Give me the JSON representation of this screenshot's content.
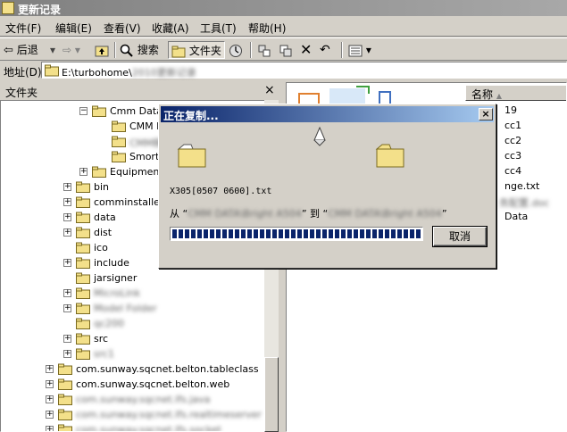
{
  "window": {
    "title": "更新记录"
  },
  "menu": [
    "文件(F)",
    "编辑(E)",
    "查看(V)",
    "收藏(A)",
    "工具(T)",
    "帮助(H)"
  ],
  "toolbar": {
    "back": "后退",
    "search": "搜索",
    "folders": "文件夹"
  },
  "address": {
    "label": "地址(D)",
    "path": "E:\\turbohome\\",
    "path_blurred": "2010更新记录"
  },
  "folders_pane": {
    "title": "文件夹",
    "close": "×"
  },
  "tree": [
    {
      "label": "Cmm Data",
      "expander": "−",
      "blurred": false
    },
    {
      "label": "CMM D",
      "expander": "",
      "blurred": false
    },
    {
      "label": "CMM精",
      "expander": "",
      "blurred": true
    },
    {
      "label": "Smorts",
      "expander": "",
      "blurred": false
    },
    {
      "label": "Equipment",
      "expander": "+",
      "blurred": false
    },
    {
      "label": "bin",
      "expander": "+",
      "blurred": false
    },
    {
      "label": "comminstaller",
      "expander": "+",
      "blurred": false
    },
    {
      "label": "data",
      "expander": "+",
      "blurred": false
    },
    {
      "label": "dist",
      "expander": "+",
      "blurred": false
    },
    {
      "label": "ico",
      "expander": "",
      "blurred": false
    },
    {
      "label": "include",
      "expander": "+",
      "blurred": false
    },
    {
      "label": "jarsigner",
      "expander": "",
      "blurred": false
    },
    {
      "label": "MicroLink",
      "expander": "+",
      "blurred": true
    },
    {
      "label": "Model Folder",
      "expander": "+",
      "blurred": true
    },
    {
      "label": "qc200",
      "expander": "",
      "blurred": true
    },
    {
      "label": "src",
      "expander": "+",
      "blurred": false
    },
    {
      "label": "src1",
      "expander": "+",
      "blurred": true
    },
    {
      "label": "com.sunway.sqcnet.belton.tableclass",
      "expander": "+",
      "blurred": false
    },
    {
      "label": "com.sunway.sqcnet.belton.web",
      "expander": "+",
      "blurred": false
    },
    {
      "label": "com.sunway.sqcnet.lfs.java",
      "expander": "+",
      "blurred": true
    },
    {
      "label": "com.sunway.sqcnet.lfs.realtimeserver",
      "expander": "+",
      "blurred": true
    },
    {
      "label": "com.sunway.sqcnet.lfs.socket",
      "expander": "+",
      "blurred": true
    }
  ],
  "list": {
    "column_name": "名称",
    "sort_indicator": "▲",
    "items": [
      "19",
      "cc1",
      "cc2",
      "cc3",
      "cc4",
      "nge.txt",
      "Data"
    ],
    "items_blurred": [
      "务配置.doc"
    ]
  },
  "dialog": {
    "title": "正在复制...",
    "close": "×",
    "file": "X305[0507 0600].txt",
    "from_label": "从",
    "to_label": "到",
    "from_path": "CMM DATA\\Bright A504",
    "to_path": "CMM DATA\\Bright A504",
    "progress": 1.0,
    "cancel": "取消"
  },
  "colors": {
    "dialog_title": "#0a246a",
    "progress": "#0a246a",
    "folder": "#f3e08a"
  }
}
